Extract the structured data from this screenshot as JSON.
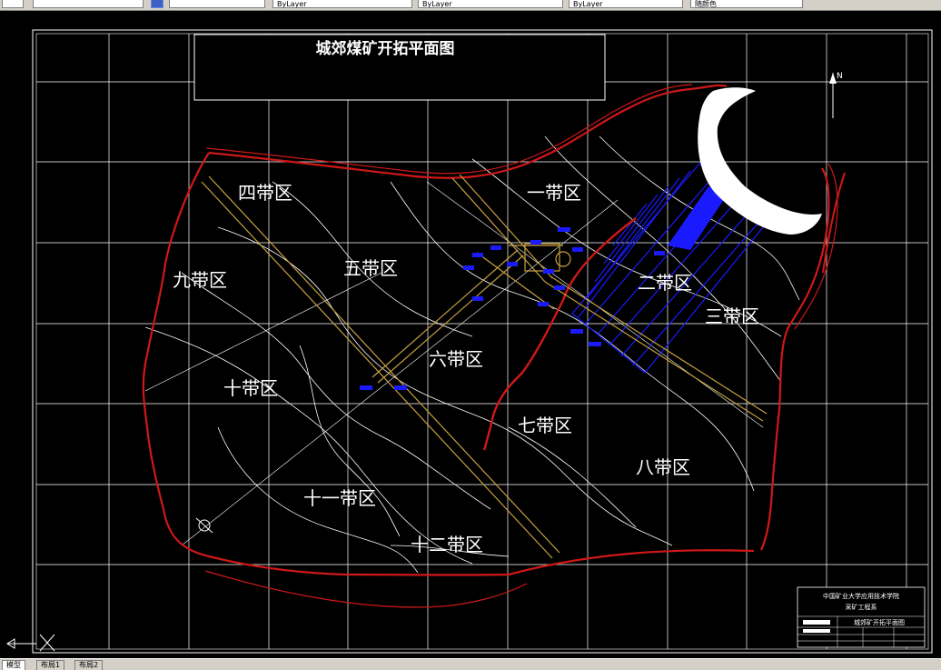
{
  "toolbar": {
    "fields": [
      "",
      "",
      "ByLayer",
      "ByLayer",
      "ByLayer",
      "随颜色"
    ]
  },
  "drawing": {
    "title": "城郊煤矿开拓平面图",
    "north_label": "N",
    "zones": {
      "z1": "一带区",
      "z2": "二带区",
      "z3": "三带区",
      "z4": "四带区",
      "z5": "五带区",
      "z6": "六带区",
      "z7": "七带区",
      "z8": "八带区",
      "z9": "九带区",
      "z10": "十带区",
      "z11": "十一带区",
      "z12": "十二带区"
    },
    "title_block": {
      "institution": "中国矿业大学应用技术学院",
      "department": "采矿工程系",
      "drawing_name": "城郊矿开拓平面图"
    }
  },
  "statusbar": {
    "tabs": [
      "模型",
      "布局1",
      "布局2"
    ]
  },
  "colors": {
    "background": "#000000",
    "grid": "#ffffff",
    "boundary": "#d01818",
    "roadway": "#c8a040",
    "mined_area": "#1a1aff",
    "river": "#ffffff"
  }
}
